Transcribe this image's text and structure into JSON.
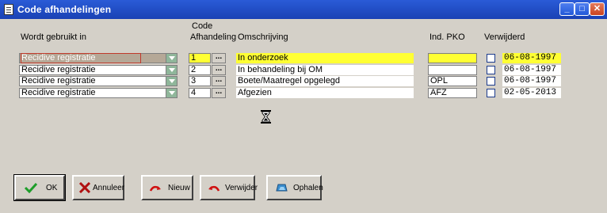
{
  "window": {
    "title": "Code afhandelingen",
    "minimize_glyph": "_",
    "maximize_glyph": "□",
    "close_glyph": "✕"
  },
  "headers": {
    "wordt_gebruikt_in": "Wordt gebruikt in",
    "code_line1": "Code",
    "code_line2": "Afhandeling",
    "omschrijving": "Omschrijving",
    "ind_pko": "Ind. PKO",
    "verwijderd": "Verwijderd"
  },
  "ellipsis_label": "...",
  "rows": [
    {
      "gebruikt_in": "Recidive registratie",
      "code": "1",
      "omschrijving": "In onderzoek",
      "pko": "",
      "verwijderd": "06-08-1997",
      "highlight": true,
      "focused": true
    },
    {
      "gebruikt_in": "Recidive registratie",
      "code": "2",
      "omschrijving": "In behandeling bij OM",
      "pko": "",
      "verwijderd": "06-08-1997",
      "highlight": false,
      "focused": false
    },
    {
      "gebruikt_in": "Recidive registratie",
      "code": "3",
      "omschrijving": "Boete/Maatregel opgelegd",
      "pko": "OPL",
      "verwijderd": "06-08-1997",
      "highlight": false,
      "focused": false
    },
    {
      "gebruikt_in": "Recidive registratie",
      "code": "4",
      "omschrijving": "Afgezien",
      "pko": "AFZ",
      "verwijderd": "02-05-2013",
      "highlight": false,
      "focused": false
    }
  ],
  "buttons": {
    "ok": "OK",
    "annuleer": "Annuleer",
    "nieuw": "Nieuw",
    "verwijder": "Verwijder",
    "ophalen": "Ophalen"
  },
  "colors": {
    "highlight": "#ffff33",
    "titlebar": "#2a5bd7"
  },
  "icons": [
    "document-icon",
    "hourglass-icon",
    "checkmark-icon",
    "cross-icon",
    "new-arrow-icon",
    "delete-arrow-icon",
    "fetch-icon"
  ]
}
